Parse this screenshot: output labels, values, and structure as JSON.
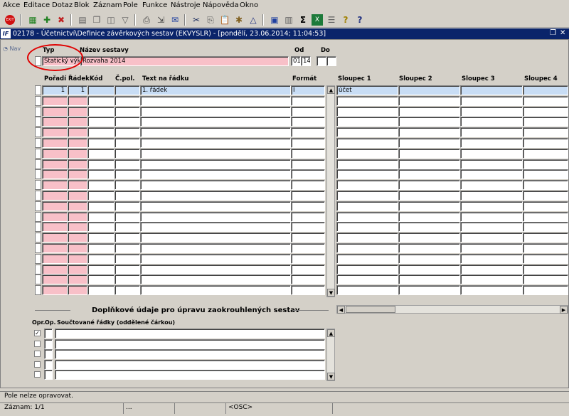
{
  "menu": [
    "Akce",
    "Editace",
    "Dotaz",
    "Blok",
    "Záznam",
    "Pole",
    "Funkce",
    "Nástroje",
    "Nápověda",
    "Okno"
  ],
  "toolbar_icons": [
    "exit-icon",
    "save-icon",
    "new-record-icon",
    "delete-record-icon",
    "print-preview-icon",
    "duplicate-icon",
    "clear-icon",
    "filter-icon",
    "print-icon",
    "export-icon",
    "email-icon",
    "cut-icon",
    "copy-icon",
    "paste-icon",
    "settings-icon",
    "calendar-icon",
    "calculator-icon",
    "sigma-icon",
    "excel-icon",
    "list-icon",
    "help-icon",
    "context-help-icon"
  ],
  "window": {
    "title": "02178 - Účetnictví\\Definice závěrkových sestav (EKVYSLR) - [pondělí, 23.06.2014; 11:04:53]",
    "app_icon": "IF"
  },
  "nav_label": "Nav",
  "header": {
    "typ_label": "Typ",
    "nazev_label": "Název sestavy",
    "od_label": "Od",
    "do_label": "Do",
    "typ_value": "Statický výka",
    "nazev_value": "Rozvaha 2014",
    "od_value_1": "01",
    "od_value_2": "14",
    "do_value_1": "",
    "do_value_2": ""
  },
  "grid": {
    "columns": [
      "Pořadí",
      "Řádek",
      "Kód",
      "Č.pol.",
      "Text na řádku",
      "Formát",
      "Sloupec 1",
      "Sloupec 2",
      "Sloupec 3",
      "Sloupec 4"
    ],
    "rows": [
      {
        "poradi": "1",
        "radek": "1",
        "kod": "",
        "cpol": "",
        "text": "1. řádek",
        "format": "I",
        "s1": "účet",
        "s2": "",
        "s3": "",
        "s4": ""
      }
    ],
    "visible_row_count": 20
  },
  "section": {
    "title": "Doplňkové údaje pro úpravu zaokrouhlených sestav",
    "opr_label": "Opr.",
    "op_label": "Op.",
    "soucet_label": "Součtované řádky (oddělené čárkou)",
    "rows": 5,
    "first_checked": true
  },
  "status": {
    "message": "Pole nelze opravovat.",
    "record": "Záznam: 1/1",
    "seg2": "...",
    "seg3": "",
    "osc": "<OSC>"
  }
}
